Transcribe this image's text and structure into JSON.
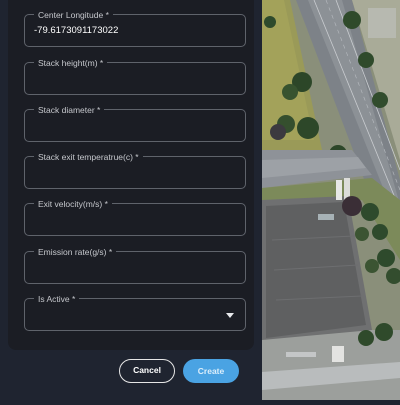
{
  "form": {
    "fields": [
      {
        "label": "Center Longitude *",
        "value": "-79.6173091173022"
      },
      {
        "label": "Stack height(m) *",
        "value": ""
      },
      {
        "label": "Stack diameter *",
        "value": ""
      },
      {
        "label": "Stack exit temperatrue(c) *",
        "value": ""
      },
      {
        "label": "Exit velocity(m/s) *",
        "value": ""
      },
      {
        "label": "Emission rate(g/s) *",
        "value": ""
      },
      {
        "label": "Is Active *",
        "value": ""
      }
    ]
  },
  "actions": {
    "cancel_label": "Cancel",
    "create_label": "Create"
  },
  "colors": {
    "panel_bg": "#1f2430",
    "card_bg": "#1b1d24",
    "border": "#5f636b",
    "primary": "#4aa3e3"
  },
  "icons": {
    "select_caret": "chevron-down-icon"
  }
}
